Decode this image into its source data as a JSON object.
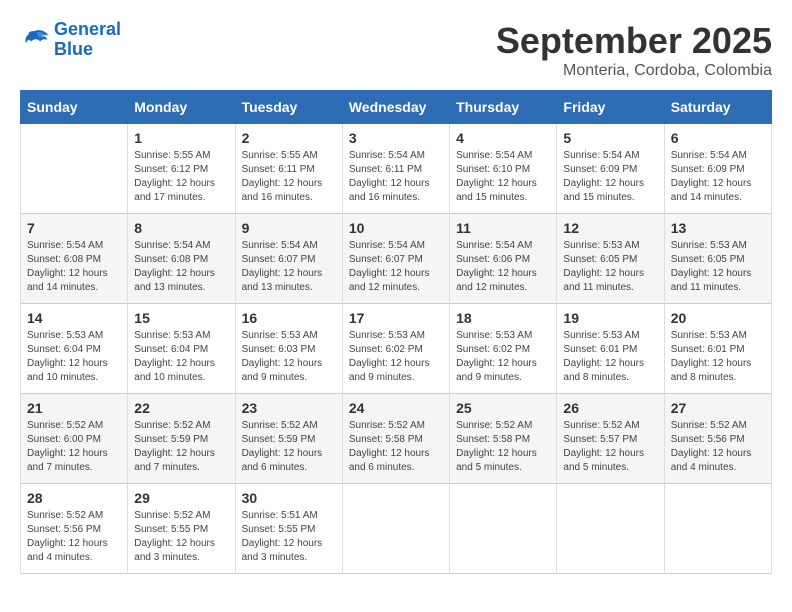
{
  "header": {
    "logo_line1": "General",
    "logo_line2": "Blue",
    "month": "September 2025",
    "location": "Monteria, Cordoba, Colombia"
  },
  "weekdays": [
    "Sunday",
    "Monday",
    "Tuesday",
    "Wednesday",
    "Thursday",
    "Friday",
    "Saturday"
  ],
  "weeks": [
    [
      {
        "day": "",
        "info": ""
      },
      {
        "day": "1",
        "info": "Sunrise: 5:55 AM\nSunset: 6:12 PM\nDaylight: 12 hours\nand 17 minutes."
      },
      {
        "day": "2",
        "info": "Sunrise: 5:55 AM\nSunset: 6:11 PM\nDaylight: 12 hours\nand 16 minutes."
      },
      {
        "day": "3",
        "info": "Sunrise: 5:54 AM\nSunset: 6:11 PM\nDaylight: 12 hours\nand 16 minutes."
      },
      {
        "day": "4",
        "info": "Sunrise: 5:54 AM\nSunset: 6:10 PM\nDaylight: 12 hours\nand 15 minutes."
      },
      {
        "day": "5",
        "info": "Sunrise: 5:54 AM\nSunset: 6:09 PM\nDaylight: 12 hours\nand 15 minutes."
      },
      {
        "day": "6",
        "info": "Sunrise: 5:54 AM\nSunset: 6:09 PM\nDaylight: 12 hours\nand 14 minutes."
      }
    ],
    [
      {
        "day": "7",
        "info": "Sunrise: 5:54 AM\nSunset: 6:08 PM\nDaylight: 12 hours\nand 14 minutes."
      },
      {
        "day": "8",
        "info": "Sunrise: 5:54 AM\nSunset: 6:08 PM\nDaylight: 12 hours\nand 13 minutes."
      },
      {
        "day": "9",
        "info": "Sunrise: 5:54 AM\nSunset: 6:07 PM\nDaylight: 12 hours\nand 13 minutes."
      },
      {
        "day": "10",
        "info": "Sunrise: 5:54 AM\nSunset: 6:07 PM\nDaylight: 12 hours\nand 12 minutes."
      },
      {
        "day": "11",
        "info": "Sunrise: 5:54 AM\nSunset: 6:06 PM\nDaylight: 12 hours\nand 12 minutes."
      },
      {
        "day": "12",
        "info": "Sunrise: 5:53 AM\nSunset: 6:05 PM\nDaylight: 12 hours\nand 11 minutes."
      },
      {
        "day": "13",
        "info": "Sunrise: 5:53 AM\nSunset: 6:05 PM\nDaylight: 12 hours\nand 11 minutes."
      }
    ],
    [
      {
        "day": "14",
        "info": "Sunrise: 5:53 AM\nSunset: 6:04 PM\nDaylight: 12 hours\nand 10 minutes."
      },
      {
        "day": "15",
        "info": "Sunrise: 5:53 AM\nSunset: 6:04 PM\nDaylight: 12 hours\nand 10 minutes."
      },
      {
        "day": "16",
        "info": "Sunrise: 5:53 AM\nSunset: 6:03 PM\nDaylight: 12 hours\nand 9 minutes."
      },
      {
        "day": "17",
        "info": "Sunrise: 5:53 AM\nSunset: 6:02 PM\nDaylight: 12 hours\nand 9 minutes."
      },
      {
        "day": "18",
        "info": "Sunrise: 5:53 AM\nSunset: 6:02 PM\nDaylight: 12 hours\nand 9 minutes."
      },
      {
        "day": "19",
        "info": "Sunrise: 5:53 AM\nSunset: 6:01 PM\nDaylight: 12 hours\nand 8 minutes."
      },
      {
        "day": "20",
        "info": "Sunrise: 5:53 AM\nSunset: 6:01 PM\nDaylight: 12 hours\nand 8 minutes."
      }
    ],
    [
      {
        "day": "21",
        "info": "Sunrise: 5:52 AM\nSunset: 6:00 PM\nDaylight: 12 hours\nand 7 minutes."
      },
      {
        "day": "22",
        "info": "Sunrise: 5:52 AM\nSunset: 5:59 PM\nDaylight: 12 hours\nand 7 minutes."
      },
      {
        "day": "23",
        "info": "Sunrise: 5:52 AM\nSunset: 5:59 PM\nDaylight: 12 hours\nand 6 minutes."
      },
      {
        "day": "24",
        "info": "Sunrise: 5:52 AM\nSunset: 5:58 PM\nDaylight: 12 hours\nand 6 minutes."
      },
      {
        "day": "25",
        "info": "Sunrise: 5:52 AM\nSunset: 5:58 PM\nDaylight: 12 hours\nand 5 minutes."
      },
      {
        "day": "26",
        "info": "Sunrise: 5:52 AM\nSunset: 5:57 PM\nDaylight: 12 hours\nand 5 minutes."
      },
      {
        "day": "27",
        "info": "Sunrise: 5:52 AM\nSunset: 5:56 PM\nDaylight: 12 hours\nand 4 minutes."
      }
    ],
    [
      {
        "day": "28",
        "info": "Sunrise: 5:52 AM\nSunset: 5:56 PM\nDaylight: 12 hours\nand 4 minutes."
      },
      {
        "day": "29",
        "info": "Sunrise: 5:52 AM\nSunset: 5:55 PM\nDaylight: 12 hours\nand 3 minutes."
      },
      {
        "day": "30",
        "info": "Sunrise: 5:51 AM\nSunset: 5:55 PM\nDaylight: 12 hours\nand 3 minutes."
      },
      {
        "day": "",
        "info": ""
      },
      {
        "day": "",
        "info": ""
      },
      {
        "day": "",
        "info": ""
      },
      {
        "day": "",
        "info": ""
      }
    ]
  ]
}
